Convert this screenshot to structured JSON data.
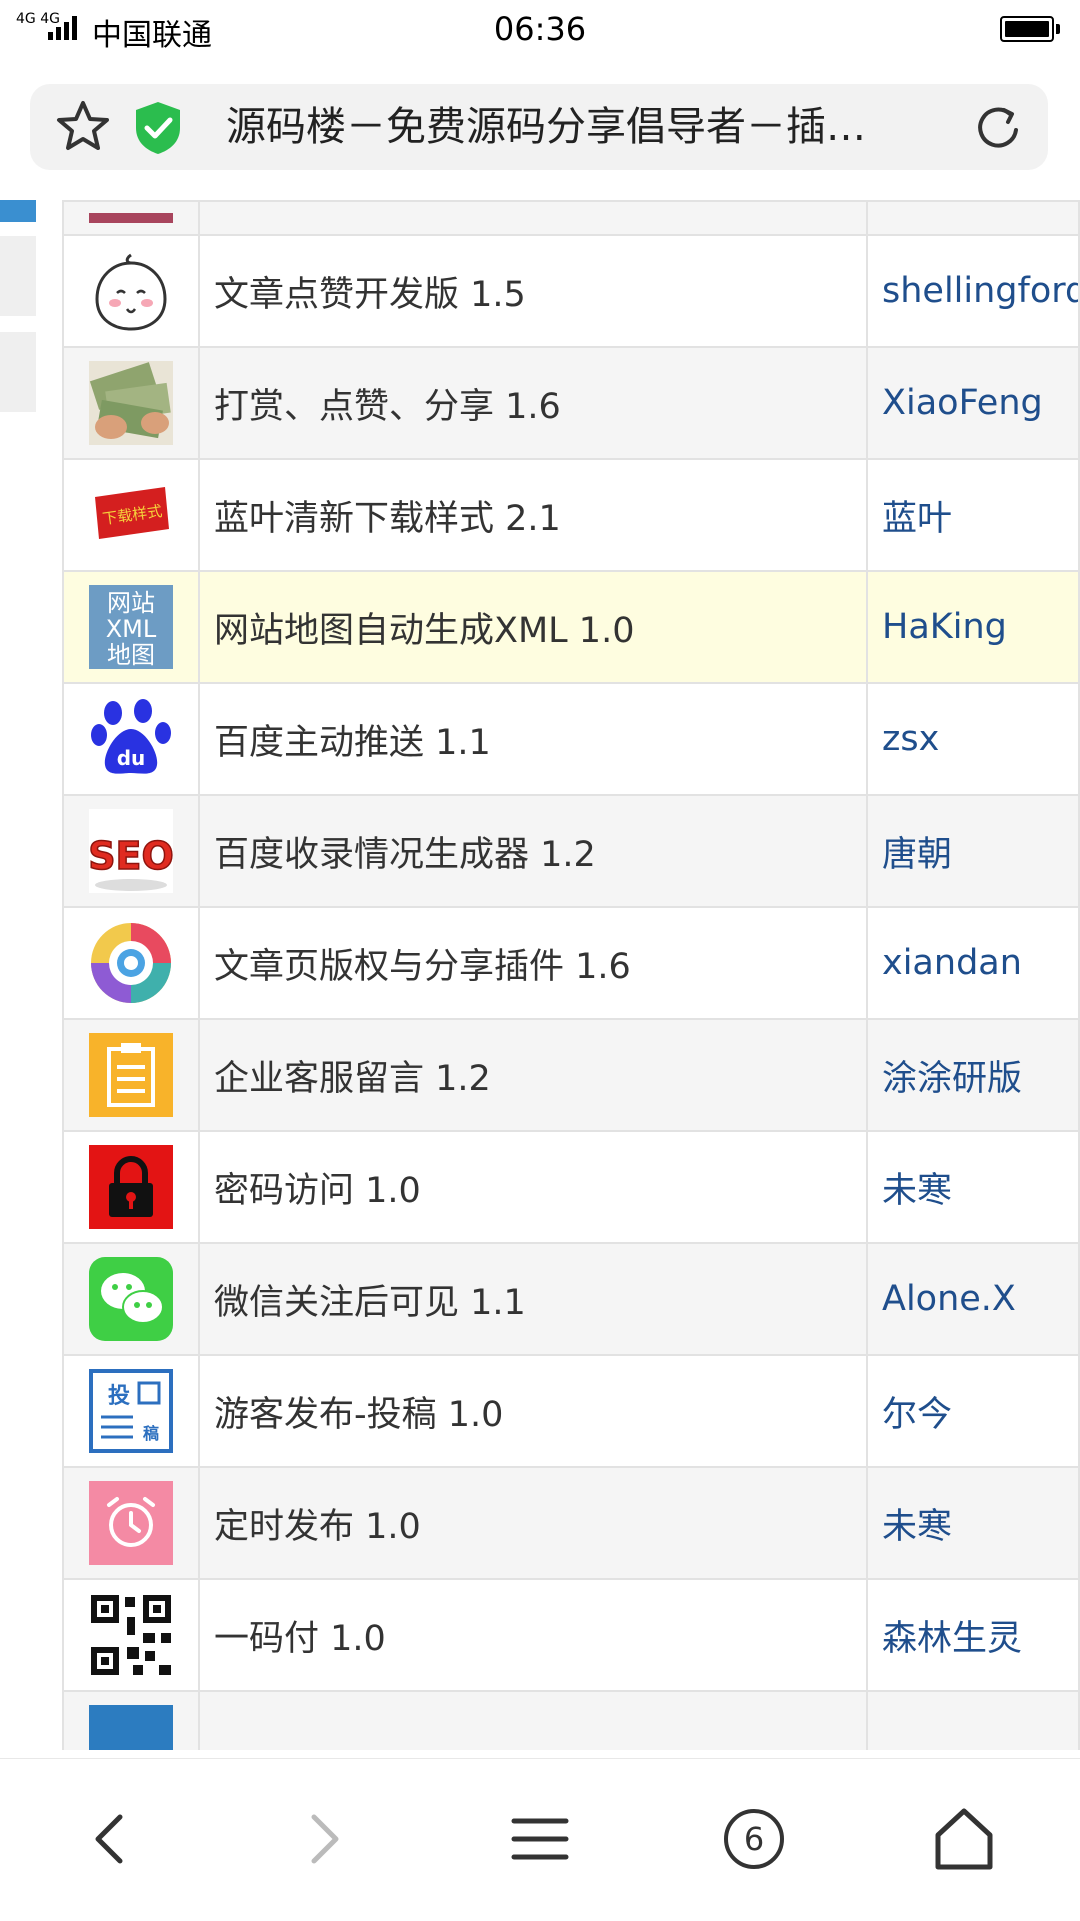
{
  "status_bar": {
    "network_type": "4G 4G",
    "carrier": "中国联通",
    "time": "06:36"
  },
  "address_bar": {
    "title": "源码楼－免费源码分享倡导者－插…"
  },
  "plugins": [
    {
      "name": "文章点赞开发版 1.5",
      "author": "shellingford",
      "icon": "bun-face-icon"
    },
    {
      "name": "打赏、点赞、分享 1.6",
      "author": "XiaoFeng",
      "icon": "money-icon"
    },
    {
      "name": "蓝叶清新下载样式 2.1",
      "author": "蓝叶",
      "icon": "download-style-icon",
      "icon_text": "下载样式"
    },
    {
      "name": "网站地图自动生成XML 1.0",
      "author": "HaKing",
      "icon": "sitemap-xml-icon",
      "icon_text": [
        "网站",
        "XML",
        "地图"
      ]
    },
    {
      "name": "百度主动推送 1.1",
      "author": "zsx",
      "icon": "baidu-paw-icon",
      "icon_text": "du"
    },
    {
      "name": "百度收录情况生成器 1.2",
      "author": "唐朝",
      "icon": "seo-icon",
      "icon_text": "SEO"
    },
    {
      "name": "文章页版权与分享插件 1.6",
      "author": "xiandan",
      "icon": "colorful-circle-icon"
    },
    {
      "name": "企业客服留言 1.2",
      "author": "涂涂研版",
      "icon": "clipboard-icon"
    },
    {
      "name": "密码访问 1.0",
      "author": "未寒",
      "icon": "lock-icon"
    },
    {
      "name": "微信关注后可见 1.1",
      "author": "Alone.X",
      "icon": "wechat-icon"
    },
    {
      "name": "游客发布-投稿 1.0",
      "author": "尔今",
      "icon": "contribute-icon",
      "icon_text": [
        "投",
        "稿"
      ]
    },
    {
      "name": "定时发布 1.0",
      "author": "未寒",
      "icon": "alarm-clock-icon"
    },
    {
      "name": "一码付 1.0",
      "author": "森林生灵",
      "icon": "qr-code-icon"
    }
  ],
  "bottom_nav": {
    "tabs_count": "6"
  },
  "colors": {
    "author_link": "#1f4e8c",
    "highlight_row": "#fefde0",
    "shield_green": "#2bbd4e"
  }
}
